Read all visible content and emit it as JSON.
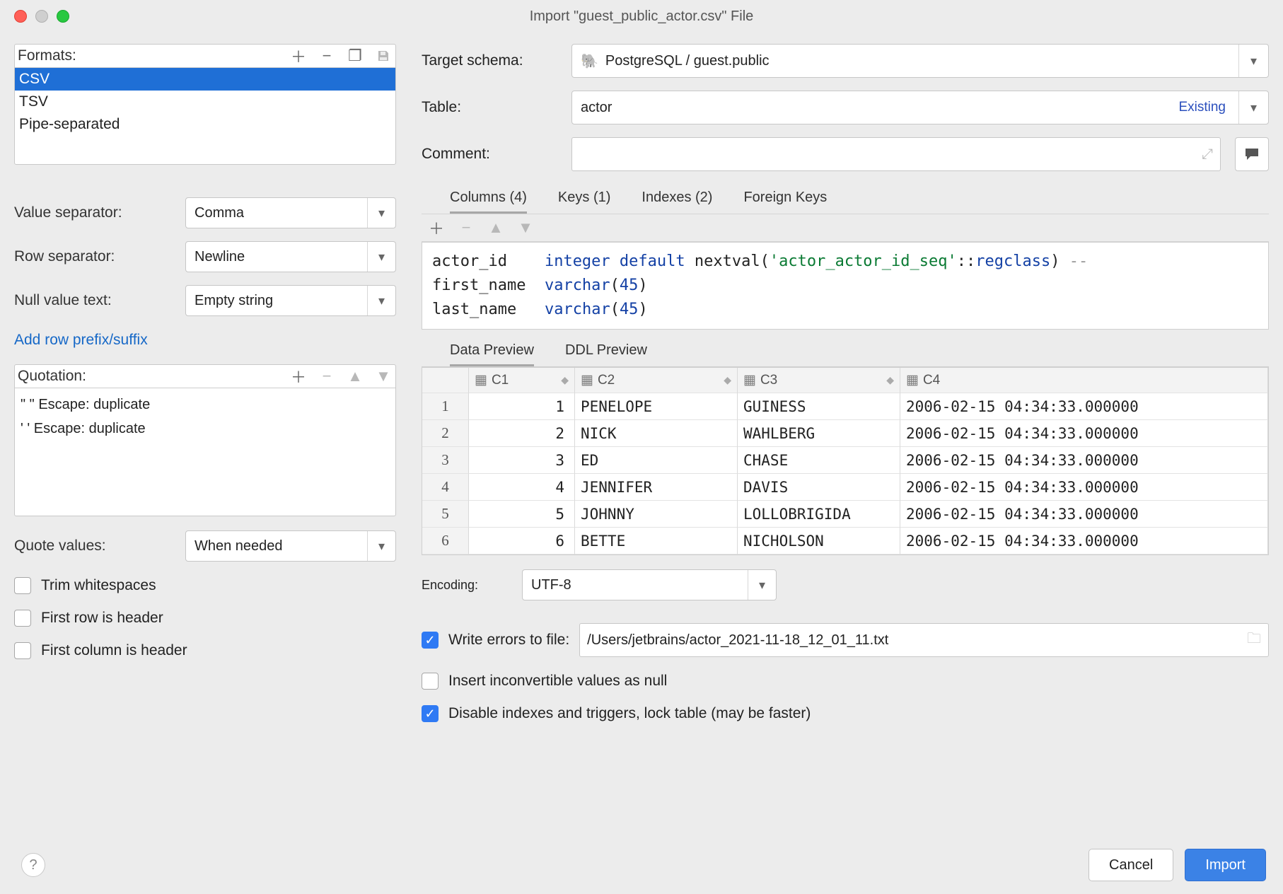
{
  "window": {
    "title": "Import \"guest_public_actor.csv\" File"
  },
  "formats": {
    "heading": "Formats:",
    "items": [
      "CSV",
      "TSV",
      "Pipe-separated"
    ],
    "selected_index": 0
  },
  "left": {
    "value_separator_label": "Value separator:",
    "value_separator": "Comma",
    "row_separator_label": "Row separator:",
    "row_separator": "Newline",
    "null_value_label": "Null value text:",
    "null_value": "Empty string",
    "add_prefix_suffix": "Add row prefix/suffix",
    "quotation_heading": "Quotation:",
    "quotation_lines": [
      "\" \"  Escape: duplicate",
      "' '  Escape: duplicate"
    ],
    "quote_values_label": "Quote values:",
    "quote_values": "When needed",
    "trim_whitespaces": "Trim whitespaces",
    "first_row_header": "First row is header",
    "first_col_header": "First column is header"
  },
  "right": {
    "target_schema_label": "Target schema:",
    "target_schema": "PostgreSQL / guest.public",
    "table_label": "Table:",
    "table_value": "actor",
    "table_badge": "Existing",
    "comment_label": "Comment:",
    "tabs_schema": {
      "columns": "Columns (4)",
      "keys": "Keys (1)",
      "indexes": "Indexes (2)",
      "fks": "Foreign Keys"
    },
    "ddl": [
      {
        "name": "actor_id",
        "type_kw": "integer",
        "extra_kw": "default",
        "extra_call": "nextval(",
        "extra_str": "'actor_actor_id_seq'",
        "extra_cast": "::",
        "extra_type": "regclass",
        "extra_close": ")",
        "trail": " --"
      },
      {
        "name": "first_name",
        "type_kw": "varchar",
        "num": "45"
      },
      {
        "name": "last_name",
        "type_kw": "varchar",
        "num": "45"
      }
    ],
    "preview_tabs": {
      "data": "Data Preview",
      "ddl": "DDL Preview"
    },
    "grid_headers": [
      "C1",
      "C2",
      "C3",
      "C4"
    ],
    "rows": [
      {
        "n": "1",
        "c1": "1",
        "c2": "PENELOPE",
        "c3": "GUINESS",
        "c4": "2006-02-15 04:34:33.000000"
      },
      {
        "n": "2",
        "c1": "2",
        "c2": "NICK",
        "c3": "WAHLBERG",
        "c4": "2006-02-15 04:34:33.000000"
      },
      {
        "n": "3",
        "c1": "3",
        "c2": "ED",
        "c3": "CHASE",
        "c4": "2006-02-15 04:34:33.000000"
      },
      {
        "n": "4",
        "c1": "4",
        "c2": "JENNIFER",
        "c3": "DAVIS",
        "c4": "2006-02-15 04:34:33.000000"
      },
      {
        "n": "5",
        "c1": "5",
        "c2": "JOHNNY",
        "c3": "LOLLOBRIGIDA",
        "c4": "2006-02-15 04:34:33.000000"
      },
      {
        "n": "6",
        "c1": "6",
        "c2": "BETTE",
        "c3": "NICHOLSON",
        "c4": "2006-02-15 04:34:33.000000"
      }
    ],
    "encoding_label": "Encoding:",
    "encoding": "UTF-8",
    "write_errors_label": "Write errors to file:",
    "write_errors_path": "/Users/jetbrains/actor_2021-11-18_12_01_11.txt",
    "insert_null": "Insert inconvertible values as null",
    "disable_indexes": "Disable indexes and triggers, lock table (may be faster)"
  },
  "buttons": {
    "cancel": "Cancel",
    "import": "Import"
  },
  "checks": {
    "trim": false,
    "first_row": false,
    "first_col": false,
    "write_errors": true,
    "insert_null": false,
    "disable_indexes": true
  }
}
